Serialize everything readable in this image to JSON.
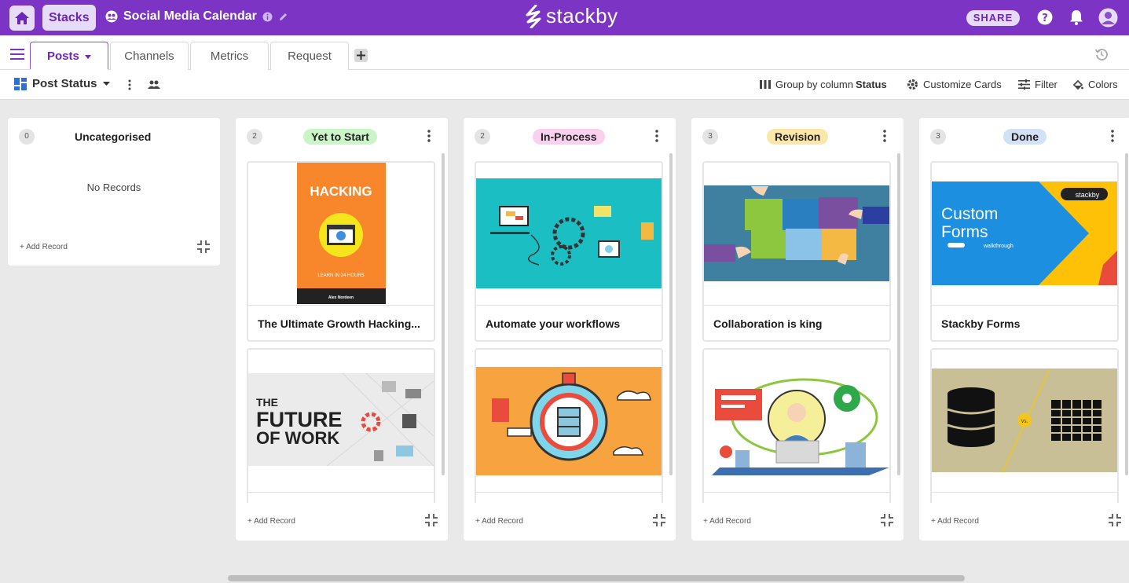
{
  "topbar": {
    "stacks_label": "Stacks",
    "stack_title": "Social Media Calendar",
    "logo_text": "stackby",
    "share_label": "SHARE",
    "accent_color": "#7b34c4"
  },
  "tabs": [
    {
      "label": "Posts",
      "active": true
    },
    {
      "label": "Channels",
      "active": false
    },
    {
      "label": "Metrics",
      "active": false
    },
    {
      "label": "Request",
      "active": false
    }
  ],
  "toolbar": {
    "view_name": "Post Status",
    "group_by_prefix": "Group by column",
    "group_by_field": "Status",
    "customize_label": "Customize Cards",
    "filter_label": "Filter",
    "colors_label": "Colors"
  },
  "columns": [
    {
      "count": "0",
      "title": "Uncategorised",
      "badge_color": "#ffffff",
      "empty_text": "No Records",
      "add_label": "+ Add Record",
      "cards": []
    },
    {
      "count": "2",
      "title": "Yet to Start",
      "badge_color": "#c9f5c7",
      "add_label": "+ Add Record",
      "cards": [
        {
          "title": "The Ultimate Growth Hacking..."
        },
        {
          "title": ""
        }
      ]
    },
    {
      "count": "2",
      "title": "In-Process",
      "badge_color": "#fad0ef",
      "add_label": "+ Add Record",
      "cards": [
        {
          "title": "Automate your workflows"
        },
        {
          "title": ""
        }
      ]
    },
    {
      "count": "3",
      "title": "Revision",
      "badge_color": "#fbe7a8",
      "add_label": "+ Add Record",
      "cards": [
        {
          "title": "Collaboration is king"
        },
        {
          "title": ""
        }
      ]
    },
    {
      "count": "3",
      "title": "Done",
      "badge_color": "#d3e1f7",
      "add_label": "+ Add Record",
      "cards": [
        {
          "title": "Stackby Forms"
        },
        {
          "title": ""
        }
      ]
    }
  ],
  "images": {
    "hacking": {
      "title": "HACKING",
      "subtitle": "LEARN IN 24 HOURS",
      "author": "Alex Nordeen"
    },
    "future": {
      "line1": "THE",
      "line2": "FUTURE",
      "line3": "OF WORK"
    },
    "forms": {
      "line1": "Custom",
      "line2": "Forms",
      "sub": "walkthrough",
      "brand": "stackby"
    },
    "db": {
      "vs": "Vs."
    }
  }
}
